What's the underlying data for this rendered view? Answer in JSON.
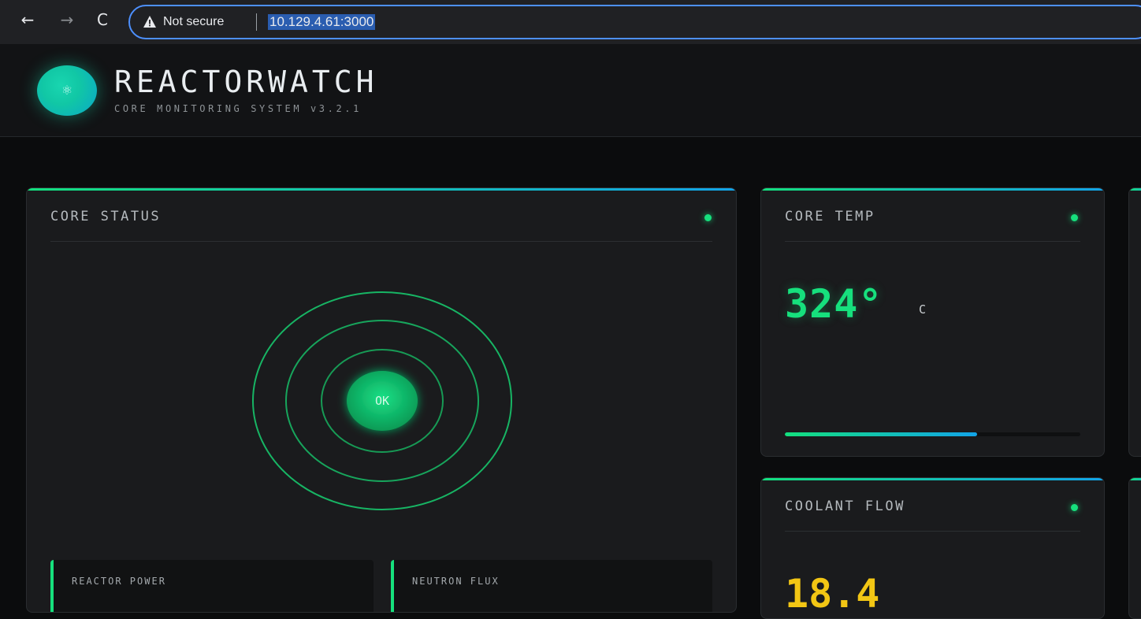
{
  "browser": {
    "security_label": "Not secure",
    "url": "10.129.4.61:3000"
  },
  "app": {
    "brand": "REACTORWATCH",
    "subtitle": "CORE MONITORING SYSTEM v3.2.1",
    "accent_green": "#16e07d",
    "accent_blue": "#12a4e8",
    "warning_yellow": "#f2c614"
  },
  "core_status": {
    "title": "CORE STATUS",
    "status_text": "OK",
    "metrics": [
      {
        "label": "REACTOR POWER"
      },
      {
        "label": "NEUTRON FLUX"
      }
    ]
  },
  "core_temp": {
    "title": "CORE TEMP",
    "value": "324°",
    "unit": "C",
    "progress_percent": 65
  },
  "coolant_flow": {
    "title": "COOLANT FLOW",
    "value": "18.4"
  }
}
